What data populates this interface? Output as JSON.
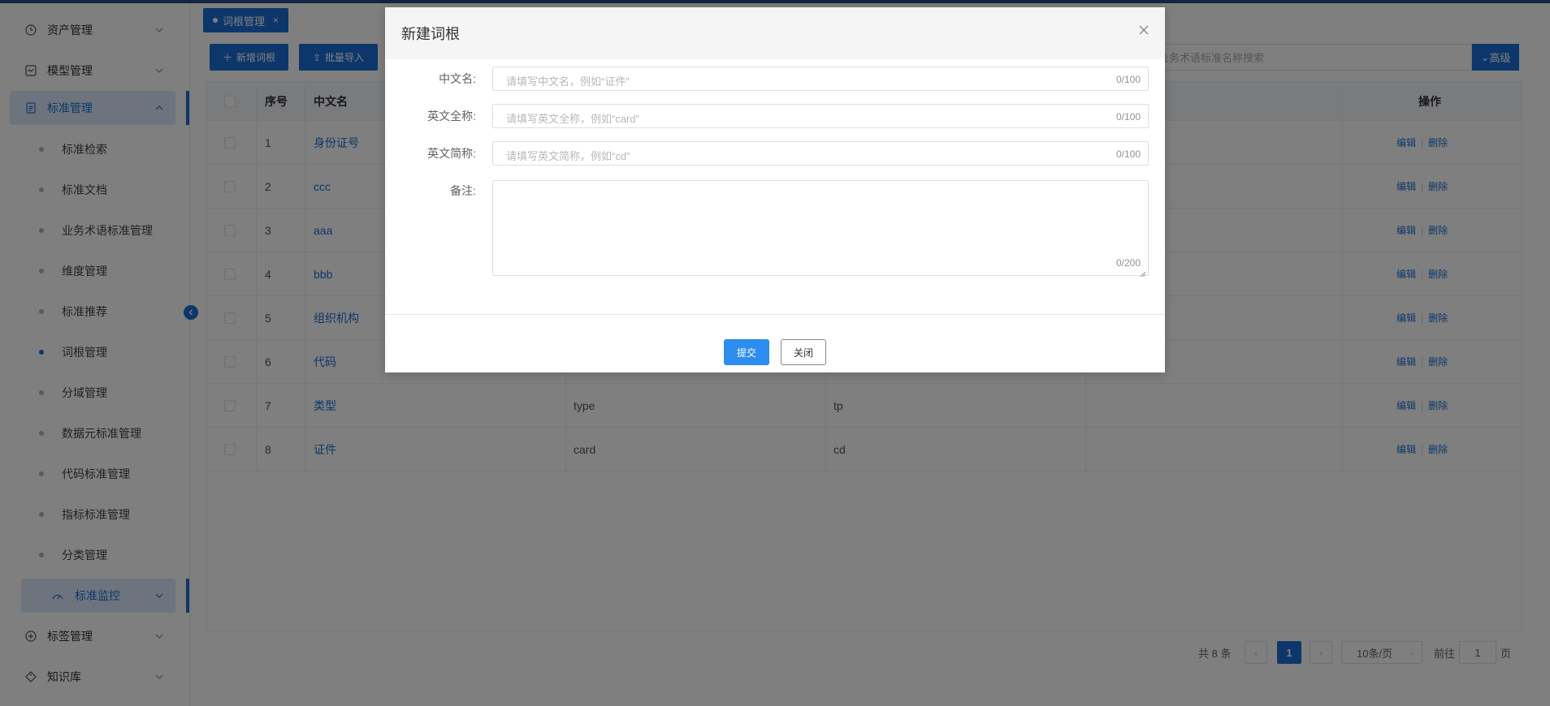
{
  "sidebar": {
    "items": [
      {
        "label": "资产管理",
        "icon": "clock-icon"
      },
      {
        "label": "模型管理",
        "icon": "model-icon"
      },
      {
        "label": "标准管理",
        "icon": "document-icon"
      },
      {
        "label": "标签管理",
        "icon": "plus-circle-icon"
      },
      {
        "label": "知识库",
        "icon": "tag-icon"
      }
    ],
    "sub_items": [
      "标准检索",
      "标准文档",
      "业务术语标准管理",
      "维度管理",
      "标准推荐",
      "词根管理",
      "分域管理",
      "数据元标准管理",
      "代码标准管理",
      "指标标准管理",
      "分类管理"
    ],
    "monitor": "标准监控"
  },
  "tab": {
    "label": "词根管理",
    "close": "×"
  },
  "toolbar": {
    "add_label": "新增词根",
    "import_label": "批量导入",
    "search_placeholder": "入业务术语标准名称搜索",
    "advanced_label": "高级"
  },
  "table": {
    "headers": {
      "index": "序号",
      "cn_name": "中文名",
      "ops": "操作"
    },
    "op_edit": "编辑",
    "op_delete": "删除",
    "rows": [
      {
        "index": "1",
        "cn": "身份证号",
        "en": "",
        "abbr": ""
      },
      {
        "index": "2",
        "cn": "ccc",
        "en": "",
        "abbr": ""
      },
      {
        "index": "3",
        "cn": "aaa",
        "en": "",
        "abbr": ""
      },
      {
        "index": "4",
        "cn": "bbb",
        "en": "",
        "abbr": ""
      },
      {
        "index": "5",
        "cn": "组织机构",
        "en": "",
        "abbr": ""
      },
      {
        "index": "6",
        "cn": "代码",
        "en": "",
        "abbr": ""
      },
      {
        "index": "7",
        "cn": "类型",
        "en": "type",
        "abbr": "tp"
      },
      {
        "index": "8",
        "cn": "证件",
        "en": "card",
        "abbr": "cd"
      }
    ]
  },
  "pagination": {
    "total": "共 8 条",
    "current_page": "1",
    "page_size": "10条/页",
    "goto_prefix": "前往",
    "goto_value": "1",
    "goto_suffix": "页"
  },
  "dialog": {
    "title": "新建词根",
    "fields": {
      "cn_label": "中文名:",
      "cn_placeholder": "请填写中文名，例如“证件”",
      "cn_count": "0/100",
      "en_label": "英文全称:",
      "en_placeholder": "请填写英文全称，例如“card”",
      "en_count": "0/100",
      "abbr_label": "英文简称:",
      "abbr_placeholder": "请填写英文简称，例如“cd”",
      "abbr_count": "0/100",
      "remark_label": "备注:",
      "remark_count": "0/200"
    },
    "submit_label": "提交",
    "close_label": "关闭"
  },
  "colors": {
    "accent": "#1a6fd6",
    "submit": "#2d8cf0",
    "overlay": "rgba(0,0,0,0.5)"
  }
}
